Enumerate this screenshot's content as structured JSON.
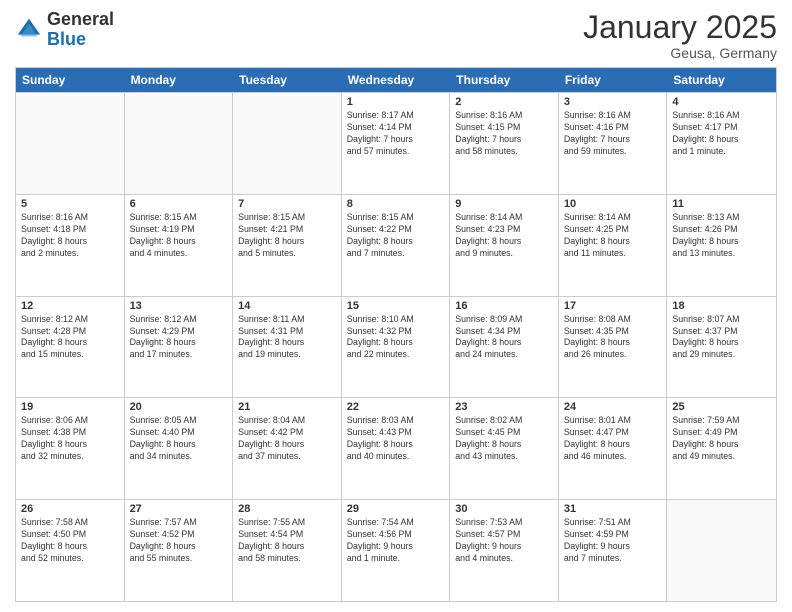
{
  "header": {
    "logo_general": "General",
    "logo_blue": "Blue",
    "month_title": "January 2025",
    "location": "Geusa, Germany"
  },
  "weekdays": [
    "Sunday",
    "Monday",
    "Tuesday",
    "Wednesday",
    "Thursday",
    "Friday",
    "Saturday"
  ],
  "rows": [
    [
      {
        "day": "",
        "info": ""
      },
      {
        "day": "",
        "info": ""
      },
      {
        "day": "",
        "info": ""
      },
      {
        "day": "1",
        "info": "Sunrise: 8:17 AM\nSunset: 4:14 PM\nDaylight: 7 hours\nand 57 minutes."
      },
      {
        "day": "2",
        "info": "Sunrise: 8:16 AM\nSunset: 4:15 PM\nDaylight: 7 hours\nand 58 minutes."
      },
      {
        "day": "3",
        "info": "Sunrise: 8:16 AM\nSunset: 4:16 PM\nDaylight: 7 hours\nand 59 minutes."
      },
      {
        "day": "4",
        "info": "Sunrise: 8:16 AM\nSunset: 4:17 PM\nDaylight: 8 hours\nand 1 minute."
      }
    ],
    [
      {
        "day": "5",
        "info": "Sunrise: 8:16 AM\nSunset: 4:18 PM\nDaylight: 8 hours\nand 2 minutes."
      },
      {
        "day": "6",
        "info": "Sunrise: 8:15 AM\nSunset: 4:19 PM\nDaylight: 8 hours\nand 4 minutes."
      },
      {
        "day": "7",
        "info": "Sunrise: 8:15 AM\nSunset: 4:21 PM\nDaylight: 8 hours\nand 5 minutes."
      },
      {
        "day": "8",
        "info": "Sunrise: 8:15 AM\nSunset: 4:22 PM\nDaylight: 8 hours\nand 7 minutes."
      },
      {
        "day": "9",
        "info": "Sunrise: 8:14 AM\nSunset: 4:23 PM\nDaylight: 8 hours\nand 9 minutes."
      },
      {
        "day": "10",
        "info": "Sunrise: 8:14 AM\nSunset: 4:25 PM\nDaylight: 8 hours\nand 11 minutes."
      },
      {
        "day": "11",
        "info": "Sunrise: 8:13 AM\nSunset: 4:26 PM\nDaylight: 8 hours\nand 13 minutes."
      }
    ],
    [
      {
        "day": "12",
        "info": "Sunrise: 8:12 AM\nSunset: 4:28 PM\nDaylight: 8 hours\nand 15 minutes."
      },
      {
        "day": "13",
        "info": "Sunrise: 8:12 AM\nSunset: 4:29 PM\nDaylight: 8 hours\nand 17 minutes."
      },
      {
        "day": "14",
        "info": "Sunrise: 8:11 AM\nSunset: 4:31 PM\nDaylight: 8 hours\nand 19 minutes."
      },
      {
        "day": "15",
        "info": "Sunrise: 8:10 AM\nSunset: 4:32 PM\nDaylight: 8 hours\nand 22 minutes."
      },
      {
        "day": "16",
        "info": "Sunrise: 8:09 AM\nSunset: 4:34 PM\nDaylight: 8 hours\nand 24 minutes."
      },
      {
        "day": "17",
        "info": "Sunrise: 8:08 AM\nSunset: 4:35 PM\nDaylight: 8 hours\nand 26 minutes."
      },
      {
        "day": "18",
        "info": "Sunrise: 8:07 AM\nSunset: 4:37 PM\nDaylight: 8 hours\nand 29 minutes."
      }
    ],
    [
      {
        "day": "19",
        "info": "Sunrise: 8:06 AM\nSunset: 4:38 PM\nDaylight: 8 hours\nand 32 minutes."
      },
      {
        "day": "20",
        "info": "Sunrise: 8:05 AM\nSunset: 4:40 PM\nDaylight: 8 hours\nand 34 minutes."
      },
      {
        "day": "21",
        "info": "Sunrise: 8:04 AM\nSunset: 4:42 PM\nDaylight: 8 hours\nand 37 minutes."
      },
      {
        "day": "22",
        "info": "Sunrise: 8:03 AM\nSunset: 4:43 PM\nDaylight: 8 hours\nand 40 minutes."
      },
      {
        "day": "23",
        "info": "Sunrise: 8:02 AM\nSunset: 4:45 PM\nDaylight: 8 hours\nand 43 minutes."
      },
      {
        "day": "24",
        "info": "Sunrise: 8:01 AM\nSunset: 4:47 PM\nDaylight: 8 hours\nand 46 minutes."
      },
      {
        "day": "25",
        "info": "Sunrise: 7:59 AM\nSunset: 4:49 PM\nDaylight: 8 hours\nand 49 minutes."
      }
    ],
    [
      {
        "day": "26",
        "info": "Sunrise: 7:58 AM\nSunset: 4:50 PM\nDaylight: 8 hours\nand 52 minutes."
      },
      {
        "day": "27",
        "info": "Sunrise: 7:57 AM\nSunset: 4:52 PM\nDaylight: 8 hours\nand 55 minutes."
      },
      {
        "day": "28",
        "info": "Sunrise: 7:55 AM\nSunset: 4:54 PM\nDaylight: 8 hours\nand 58 minutes."
      },
      {
        "day": "29",
        "info": "Sunrise: 7:54 AM\nSunset: 4:56 PM\nDaylight: 9 hours\nand 1 minute."
      },
      {
        "day": "30",
        "info": "Sunrise: 7:53 AM\nSunset: 4:57 PM\nDaylight: 9 hours\nand 4 minutes."
      },
      {
        "day": "31",
        "info": "Sunrise: 7:51 AM\nSunset: 4:59 PM\nDaylight: 9 hours\nand 7 minutes."
      },
      {
        "day": "",
        "info": ""
      }
    ]
  ]
}
